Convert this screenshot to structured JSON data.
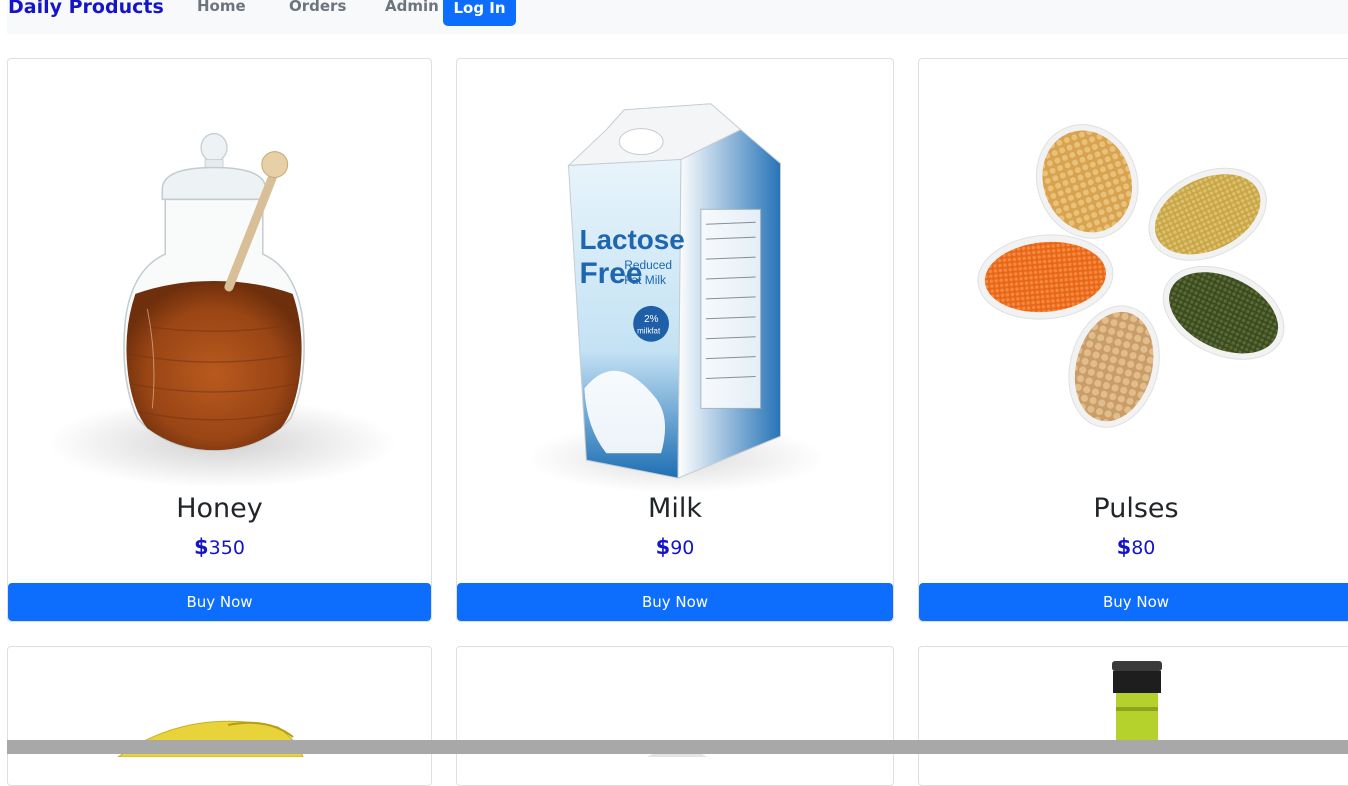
{
  "navbar": {
    "brand": "Daily Products",
    "links": [
      "Home",
      "Orders",
      "Admin"
    ],
    "login_label": "Log In"
  },
  "products": [
    {
      "name": "Honey",
      "currency": "$",
      "price": "350",
      "buy_label": "Buy Now",
      "image": "honey-jar-image"
    },
    {
      "name": "Milk",
      "currency": "$",
      "price": "90",
      "buy_label": "Buy Now",
      "image": "milk-carton-image"
    },
    {
      "name": "Pulses",
      "currency": "$",
      "price": "80",
      "buy_label": "Buy Now",
      "image": "pulses-bowls-image"
    }
  ],
  "milk_carton_text": {
    "title1": "Lactose",
    "title2": "Free",
    "sub1": "Reduced",
    "sub2": "Fat Milk",
    "badge1": "2%",
    "badge2": "milkfat"
  },
  "colors": {
    "accent": "#0d6efd",
    "brand": "#1515c8",
    "navbar_bg": "#f8f9fa"
  }
}
